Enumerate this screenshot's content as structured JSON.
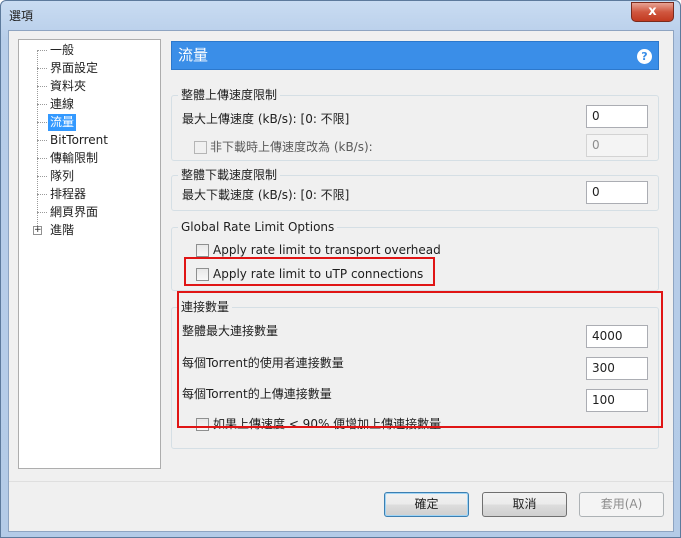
{
  "window": {
    "title": "選項",
    "close_glyph": "x"
  },
  "tree": {
    "items": [
      {
        "label": "一般"
      },
      {
        "label": "界面設定"
      },
      {
        "label": "資料夾"
      },
      {
        "label": "連線"
      },
      {
        "label": "流量",
        "selected": true
      },
      {
        "label": "BitTorrent"
      },
      {
        "label": "傳輸限制"
      },
      {
        "label": "隊列"
      },
      {
        "label": "排程器"
      },
      {
        "label": "網頁界面"
      },
      {
        "label": "進階",
        "expander": "+"
      }
    ]
  },
  "header": {
    "title": "流量",
    "help_icon": "?"
  },
  "upload_group": {
    "title": "整體上傳速度限制",
    "max_label": "最大上傳速度 (kB/s): [0: 不限]",
    "max_value": "0",
    "alt_label": "非下載時上傳速度改為 (kB/s):",
    "alt_value": "0"
  },
  "download_group": {
    "title": "整體下載速度限制",
    "max_label": "最大下載速度 (kB/s): [0: 不限]",
    "max_value": "0"
  },
  "global_group": {
    "title": "Global Rate Limit Options",
    "transport_label": "Apply rate limit to transport overhead",
    "utp_label": "Apply rate limit to uTP connections"
  },
  "connections_group": {
    "title": "連接數量",
    "global_label": "整體最大連接數量",
    "global_value": "4000",
    "peers_label": "每個Torrent的使用者連接數量",
    "peers_value": "300",
    "upload_slots_label": "每個Torrent的上傳連接數量",
    "upload_slots_value": "100",
    "boost_label": "如果上傳速度 < 90% 便增加上傳連接數量"
  },
  "buttons": {
    "ok": "確定",
    "cancel": "取消",
    "apply": "套用(A)"
  },
  "colors": {
    "accent": "#3a8ee8",
    "highlight": "#e01515"
  }
}
